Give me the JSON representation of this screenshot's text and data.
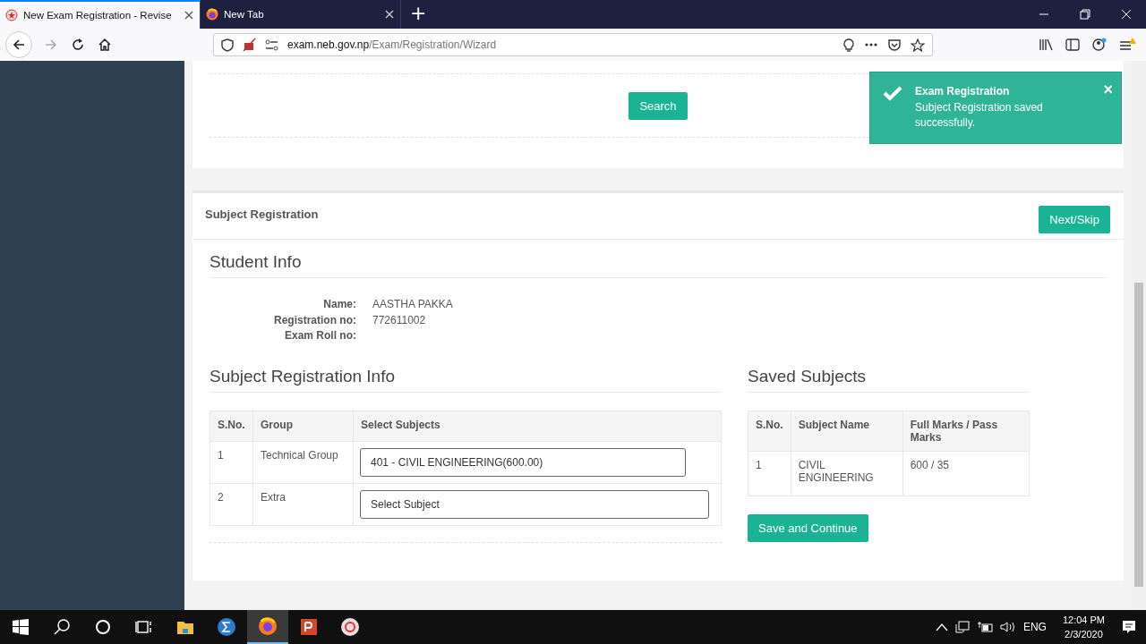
{
  "browser": {
    "tabs": [
      {
        "title": "New Exam Registration - Revise",
        "kind": "site",
        "selected": true
      },
      {
        "title": "New Tab",
        "kind": "firefox",
        "selected": false
      }
    ],
    "new_tab": "+",
    "url": {
      "host": "exam.neb.gov.np",
      "path": "/Exam/Registration/Wizard"
    }
  },
  "search_panel": {
    "button": "Search"
  },
  "toast": {
    "title": "Exam Registration",
    "message": "Subject Registration saved successfully.",
    "close": "×"
  },
  "subject_registration": {
    "title": "Subject Registration",
    "next_button": "Next/Skip"
  },
  "student_info": {
    "title": "Student Info",
    "fields": [
      {
        "label": "Name:",
        "value": "AASTHA PAKKA"
      },
      {
        "label": "Registration no:",
        "value": "772611002"
      },
      {
        "label": "Exam Roll no:"
      }
    ]
  },
  "registration_info": {
    "title": "Subject Registration Info",
    "columns": [
      "S.No.",
      "Group",
      "Select Subjects"
    ],
    "rows": [
      {
        "sno": "1",
        "group": "Technical Group",
        "value": "401 - CIVIL ENGINEERING(600.00)"
      },
      {
        "sno": "2",
        "group": "Extra",
        "placeholder": "Select Subject"
      }
    ]
  },
  "saved_subjects": {
    "title": "Saved Subjects",
    "columns": [
      "S.No.",
      "Subject Name",
      "Full Marks / Pass Marks"
    ],
    "rows": [
      {
        "sno": "1",
        "name": "CIVIL ENGINEERING",
        "marks": "600 / 35"
      }
    ],
    "button": "Save and Continue"
  },
  "taskbar": {
    "apps": [
      {
        "kind": "folder",
        "active": false
      },
      {
        "kind": "sigma",
        "active": false
      },
      {
        "kind": "firefox",
        "active": true
      },
      {
        "kind": "powerpoint",
        "active": false
      },
      {
        "kind": "circle-app",
        "active": false
      }
    ],
    "language": "ENG",
    "time": "12:04 PM",
    "date": "2/3/2020"
  }
}
